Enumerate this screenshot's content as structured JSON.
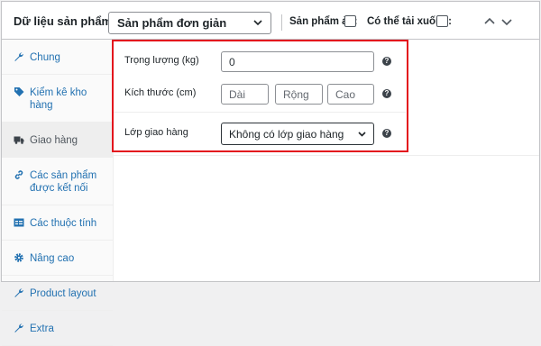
{
  "header": {
    "title": "Dữ liệu sản phẩm —",
    "product_type": "Sản phẩm đơn giản",
    "virtual_label": "Sản phẩm ảo:",
    "downloadable_label": "Có thể tải xuống:"
  },
  "sidebar": {
    "items": [
      {
        "label": "Chung",
        "icon": "wrench-icon"
      },
      {
        "label": "Kiểm kê kho hàng",
        "icon": "tag-icon"
      },
      {
        "label": "Giao hàng",
        "icon": "truck-icon",
        "active": true
      },
      {
        "label": "Các sản phẩm được kết nối",
        "icon": "link-icon"
      },
      {
        "label": "Các thuộc tính",
        "icon": "table-icon"
      },
      {
        "label": "Nâng cao",
        "icon": "gear-icon"
      },
      {
        "label": "Product layout",
        "icon": "wrench-icon"
      },
      {
        "label": "Extra",
        "icon": "wrench-icon"
      }
    ]
  },
  "shipping": {
    "weight_label": "Trọng lượng (kg)",
    "weight_value": "0",
    "dimensions_label": "Kích thước (cm)",
    "length_placeholder": "Dài",
    "width_placeholder": "Rộng",
    "height_placeholder": "Cao",
    "class_label": "Lớp giao hàng",
    "class_value": "Không có lớp giao hàng",
    "help_glyph": "?"
  },
  "colors": {
    "highlight": "#e3141d",
    "link": "#2271b1"
  }
}
